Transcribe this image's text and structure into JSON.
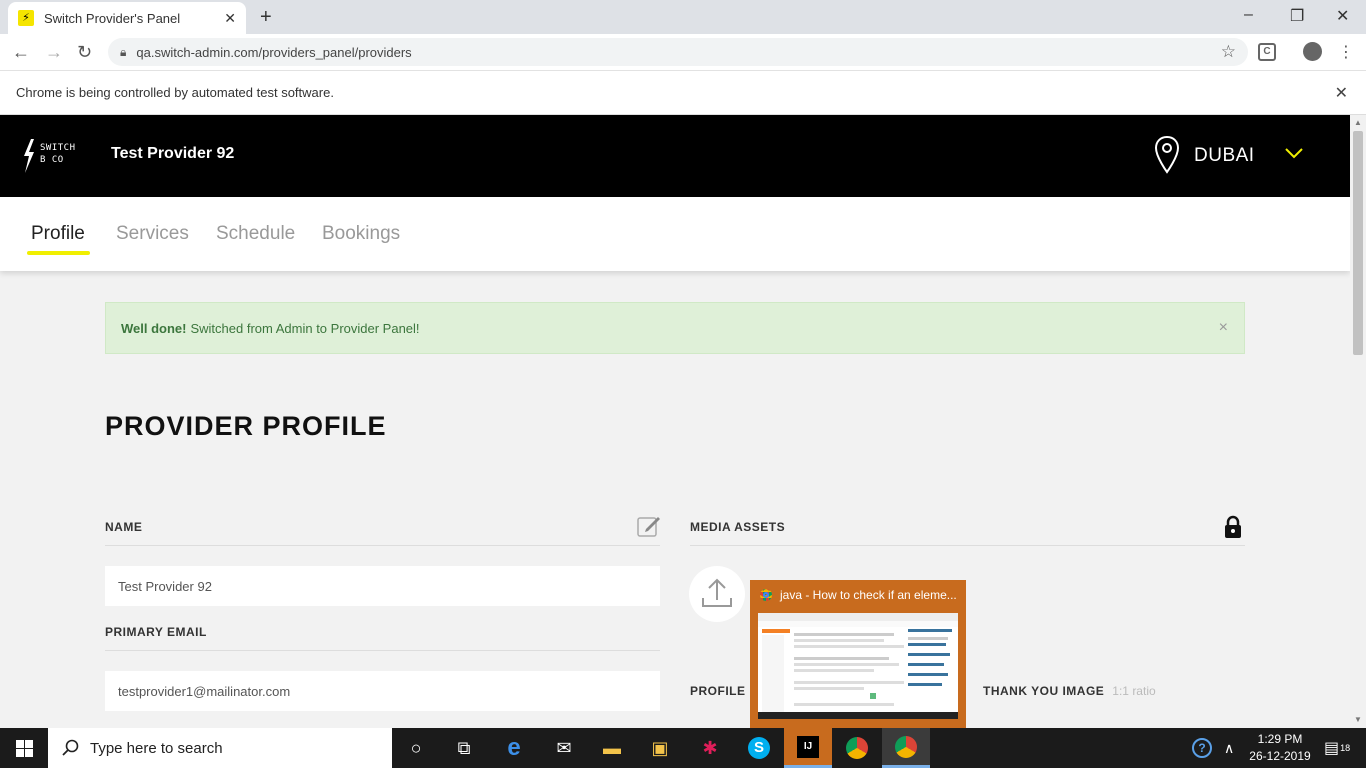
{
  "browser": {
    "tab_title": "Switch Provider's Panel",
    "favicon": "⚡",
    "url": "qa.switch-admin.com/providers_panel/providers",
    "infobar_text": "Chrome is being controlled by automated test software.",
    "ext_label": "C"
  },
  "header": {
    "logo_line1": "SWITCH",
    "logo_line2": "B CO",
    "provider_name": "Test Provider 92",
    "city": "DUBAI",
    "accent": "#f0ef00"
  },
  "nav": {
    "tabs": [
      {
        "label": "Profile"
      },
      {
        "label": "Services"
      },
      {
        "label": "Schedule"
      },
      {
        "label": "Bookings"
      }
    ]
  },
  "alert": {
    "bold": "Well done!",
    "message": "Switched from Admin to Provider Panel!",
    "close": "×"
  },
  "page": {
    "title": "PROVIDER PROFILE",
    "name_label": "NAME",
    "name_value": "Test Provider 92",
    "email_label": "PRIMARY EMAIL",
    "email_value": "testprovider1@mailinator.com",
    "media_label": "MEDIA ASSETS",
    "profile_image_label": "PROFILE I",
    "thank_you_label": "THANK YOU IMAGE",
    "ratio": "1:1 ratio"
  },
  "preview": {
    "title": "java - How to check if an eleme..."
  },
  "taskbar": {
    "search_placeholder": "Type here to search",
    "time": "1:29 PM",
    "date": "26-12-2019",
    "notif_count": "18",
    "icons": [
      "cortana-icon",
      "task-view-icon",
      "edge-icon",
      "mail-icon",
      "file-explorer-icon",
      "store-icon",
      "slack-icon",
      "skype-icon",
      "intellij-icon",
      "chrome-icon",
      "chrome-icon"
    ]
  }
}
